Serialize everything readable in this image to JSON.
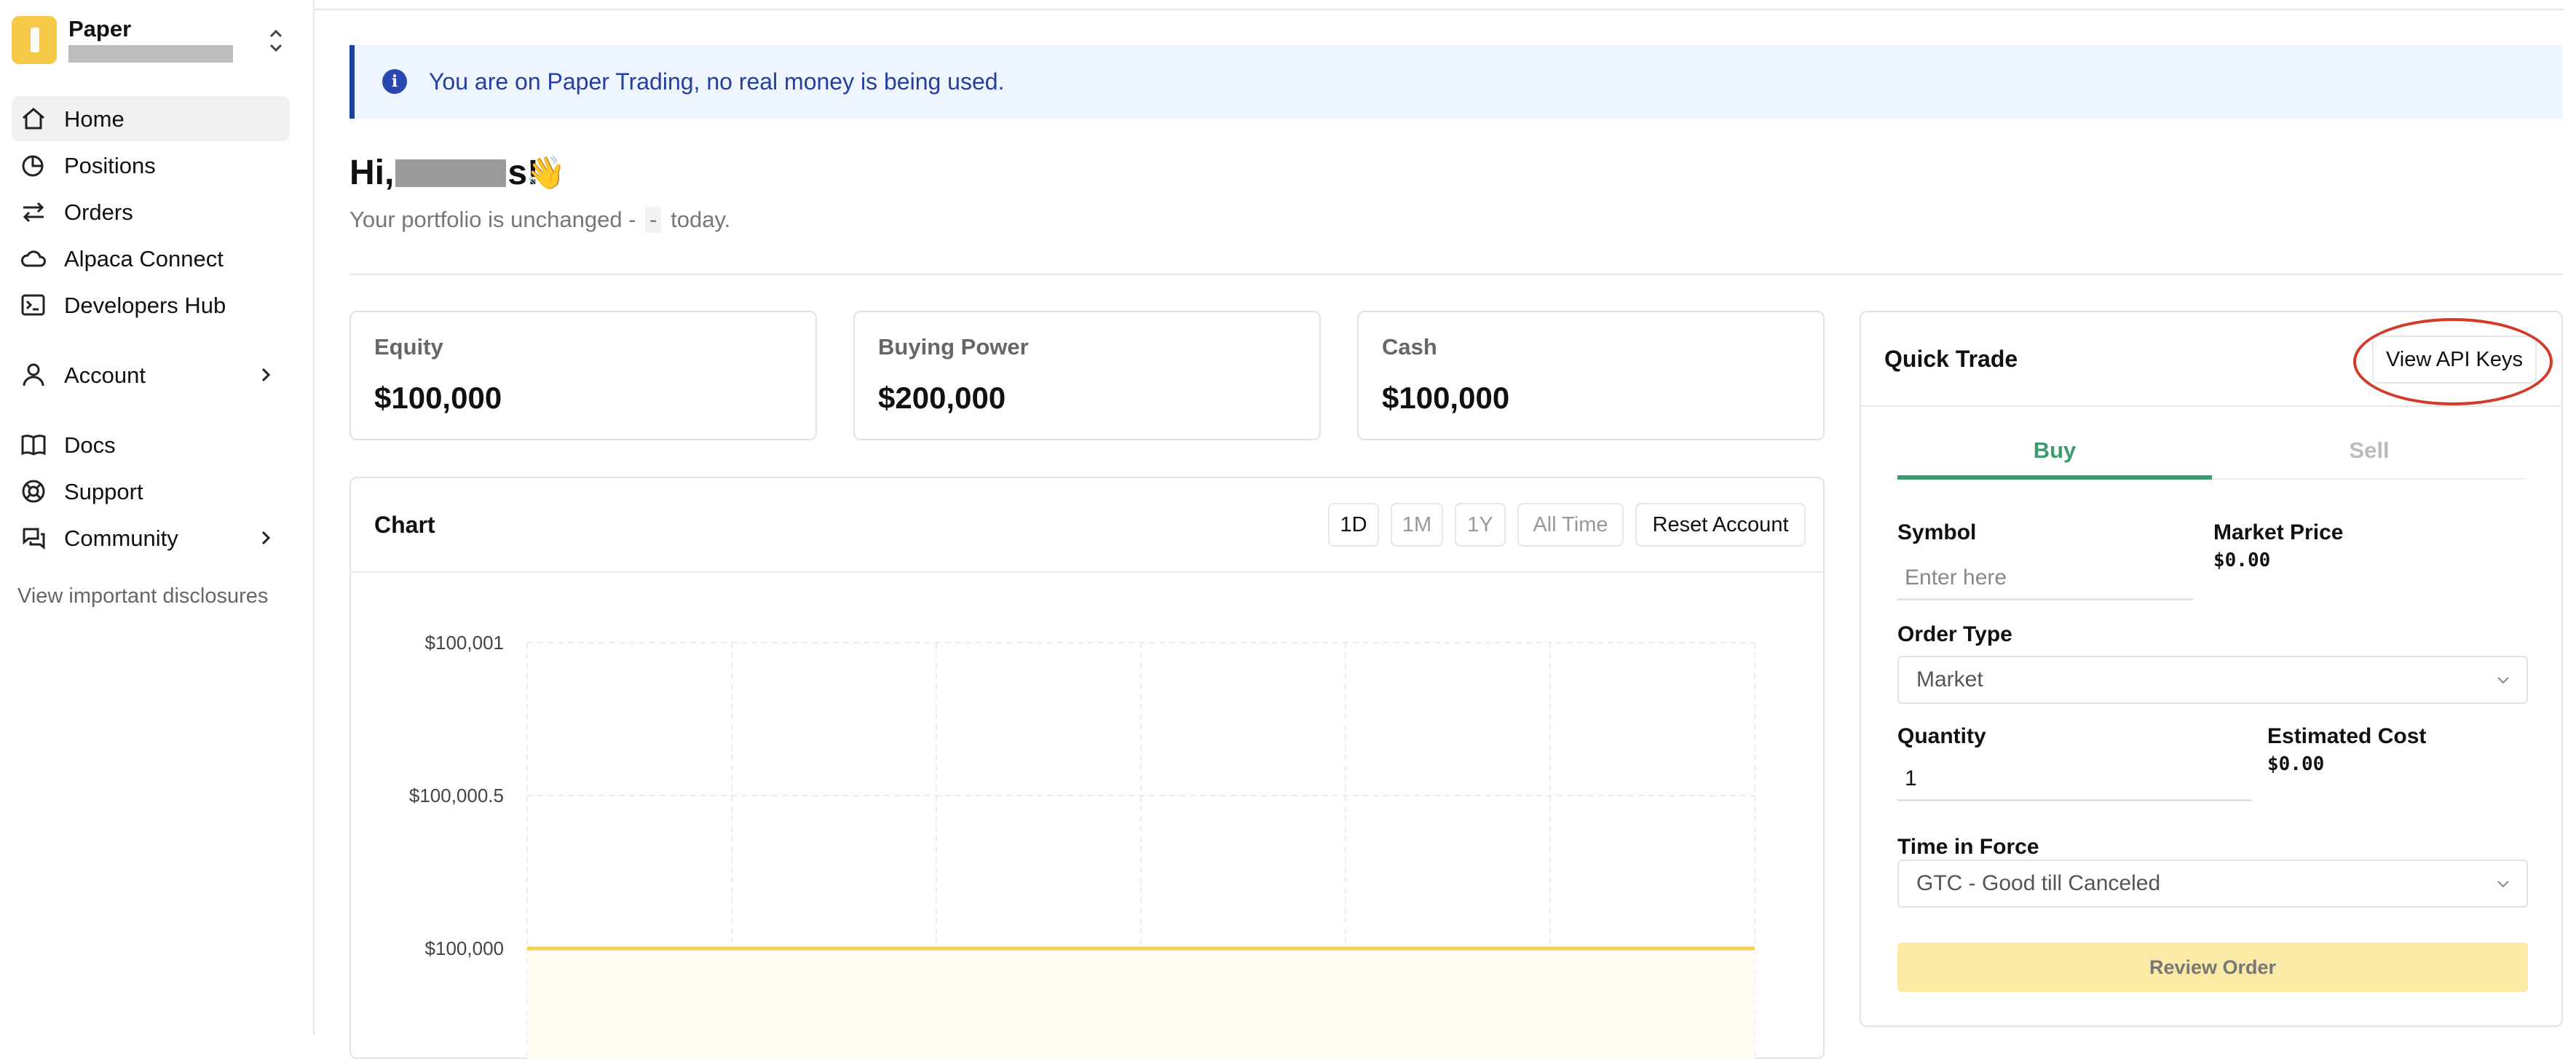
{
  "sidebar": {
    "account_name": "Paper",
    "items": [
      {
        "label": "Home",
        "icon": "home-icon",
        "active": true
      },
      {
        "label": "Positions",
        "icon": "pie-chart-icon"
      },
      {
        "label": "Orders",
        "icon": "swap-arrows-icon"
      },
      {
        "label": "Alpaca Connect",
        "icon": "cloud-icon"
      },
      {
        "label": "Developers Hub",
        "icon": "terminal-icon"
      },
      {
        "label": "Account",
        "icon": "user-icon",
        "has_submenu": true
      },
      {
        "label": "Docs",
        "icon": "book-icon"
      },
      {
        "label": "Support",
        "icon": "lifebuoy-icon"
      },
      {
        "label": "Community",
        "icon": "chat-bubbles-icon",
        "has_submenu": true
      }
    ],
    "disclosure": "View important disclosures"
  },
  "banner": {
    "text": "You are on Paper Trading, no real money is being used."
  },
  "greeting": {
    "hi": "Hi,",
    "suffix": "s!",
    "emoji": "👋",
    "sub_before": "Your portfolio is unchanged",
    "sub_dash1": "-",
    "sub_dash2": "-",
    "sub_after": "today."
  },
  "stats": [
    {
      "label": "Equity",
      "value": "$100,000"
    },
    {
      "label": "Buying Power",
      "value": "$200,000"
    },
    {
      "label": "Cash",
      "value": "$100,000"
    }
  ],
  "chart": {
    "title": "Chart",
    "timeframes": [
      {
        "label": "1D",
        "active": true
      },
      {
        "label": "1M",
        "active": false
      },
      {
        "label": "1Y",
        "active": false
      },
      {
        "label": "All Time",
        "active": false
      }
    ],
    "reset_label": "Reset Account",
    "line_color": "#f5d150"
  },
  "chart_data": {
    "type": "line",
    "ytick_labels": [
      "$100,001",
      "$100,000.5",
      "$100,000"
    ],
    "yticks": [
      100001,
      100000.5,
      100000
    ],
    "ylim": [
      99999.5,
      100001
    ],
    "grid": true,
    "series": [
      {
        "values": [
          100000,
          100000
        ]
      }
    ]
  },
  "quick_trade": {
    "title": "Quick Trade",
    "api_keys_label": "View API Keys",
    "tabs": {
      "buy": "Buy",
      "sell": "Sell"
    },
    "symbol_label": "Symbol",
    "symbol_placeholder": "Enter here",
    "market_price_label": "Market Price",
    "market_price_value": "$0.00",
    "order_type_label": "Order Type",
    "order_type_value": "Market",
    "quantity_label": "Quantity",
    "quantity_value": "1",
    "estimated_cost_label": "Estimated Cost",
    "estimated_cost_value": "$0.00",
    "tif_label": "Time in Force",
    "tif_value": "GTC - Good till Canceled",
    "review_label": "Review Order",
    "accent": "#3d9b6f"
  }
}
